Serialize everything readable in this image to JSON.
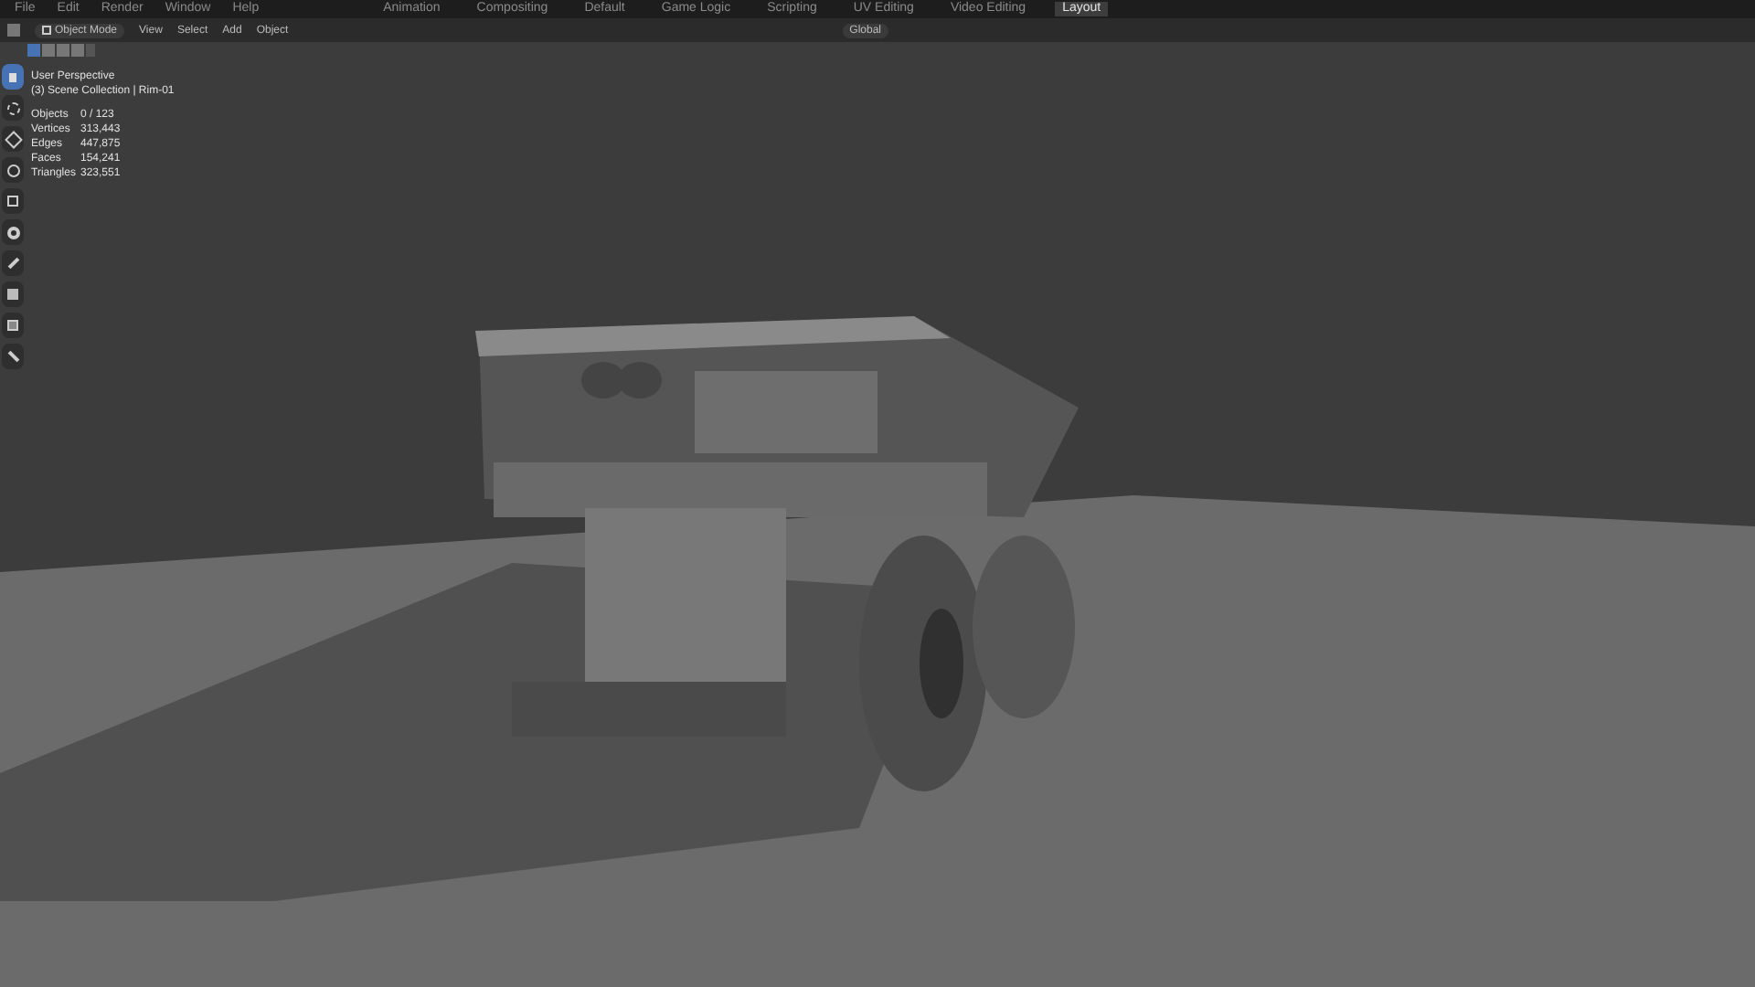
{
  "top_menu": [
    "File",
    "Edit",
    "Render",
    "Window",
    "Help"
  ],
  "workspaces": [
    {
      "label": "Animation",
      "selected": false
    },
    {
      "label": "Compositing",
      "selected": false
    },
    {
      "label": "Default",
      "selected": false
    },
    {
      "label": "Game Logic",
      "selected": false
    },
    {
      "label": "Scripting",
      "selected": false
    },
    {
      "label": "UV Editing",
      "selected": false
    },
    {
      "label": "Video Editing",
      "selected": false
    },
    {
      "label": "Layout",
      "selected": true
    }
  ],
  "header": {
    "mode": "Object Mode",
    "menus": [
      "View",
      "Select",
      "Add",
      "Object"
    ],
    "orientation": "Global"
  },
  "viewport": {
    "view_name": "User Perspective",
    "collection": "(3) Scene Collection | Rim-01",
    "stats": [
      {
        "label": "Objects",
        "value": "0 / 123"
      },
      {
        "label": "Vertices",
        "value": "313,443"
      },
      {
        "label": "Edges",
        "value": "447,875"
      },
      {
        "label": "Faces",
        "value": "154,241"
      },
      {
        "label": "Triangles",
        "value": "323,551"
      }
    ]
  },
  "toolbar": [
    {
      "kind": "select",
      "selected": true
    },
    {
      "kind": "cursor",
      "selected": false
    },
    {
      "kind": "move",
      "selected": false
    },
    {
      "kind": "rotate",
      "selected": false
    },
    {
      "kind": "scale",
      "selected": false
    },
    {
      "kind": "transform",
      "selected": false
    },
    {
      "kind": "annotate",
      "selected": false
    },
    {
      "kind": "measure",
      "selected": false
    },
    {
      "kind": "add",
      "selected": false
    },
    {
      "kind": "sample",
      "selected": false
    }
  ]
}
